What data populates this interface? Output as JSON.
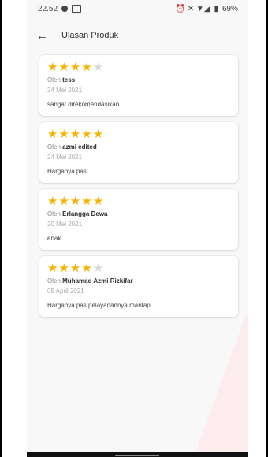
{
  "status_bar": {
    "time": "22.52",
    "right_icons": "⏰ ✕ ▼◢",
    "battery": "69%"
  },
  "header": {
    "title": "Ulasan Produk",
    "back_icon": "←"
  },
  "reviews": [
    {
      "rating": 4,
      "by_prefix": "Oleh",
      "name": "tess",
      "date": "24 Mei 2021",
      "text": "sangat direkomendasikan"
    },
    {
      "rating": 5,
      "by_prefix": "Oleh",
      "name": "azmi edited",
      "date": "24 Mei 2021",
      "text": "Harganya pas"
    },
    {
      "rating": 5,
      "by_prefix": "Oleh",
      "name": "Erlangga Dewa",
      "date": "20 Mei 2021",
      "text": "enak"
    },
    {
      "rating": 4,
      "by_prefix": "Oleh",
      "name": "Muhamad Azmi Rizkifar",
      "date": "05 April 2021",
      "text": "Harganya pas pelayanannya mantap"
    }
  ],
  "colors": {
    "star_filled": "#f5b400",
    "star_empty": "#d9d9d9",
    "background": "#f8f8f8"
  }
}
